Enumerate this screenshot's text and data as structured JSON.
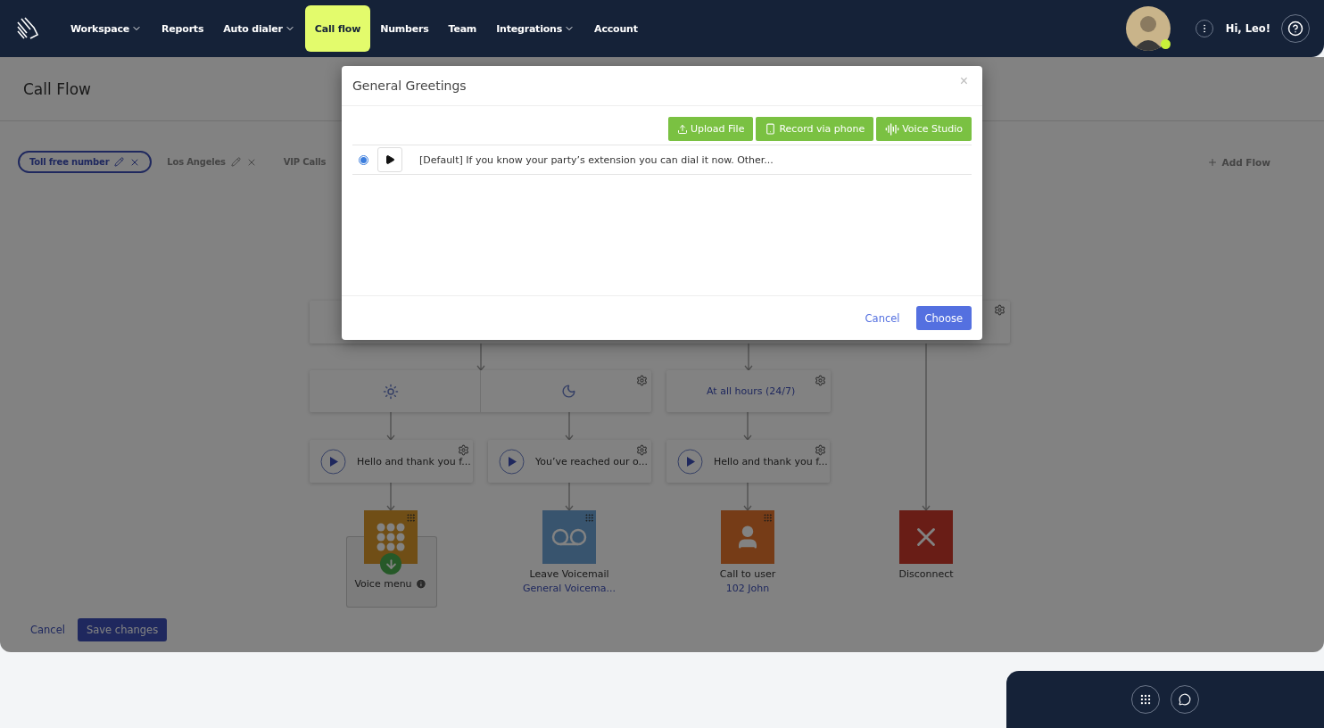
{
  "nav": {
    "items": [
      {
        "label": "Workspace",
        "has_menu": true,
        "selected": false
      },
      {
        "label": "Reports",
        "has_menu": false,
        "selected": false
      },
      {
        "label": "Auto dialer",
        "has_menu": true,
        "selected": false
      },
      {
        "label": "Call flow",
        "has_menu": false,
        "selected": true
      },
      {
        "label": "Numbers",
        "has_menu": false,
        "selected": false
      },
      {
        "label": "Team",
        "has_menu": false,
        "selected": false
      },
      {
        "label": "Integrations",
        "has_menu": true,
        "selected": false
      },
      {
        "label": "Account",
        "has_menu": false,
        "selected": false
      }
    ],
    "user": {
      "greeting": "Hi, Leo!",
      "online": true
    }
  },
  "page": {
    "title": "Call Flow",
    "flow_tabs": [
      {
        "label": "Toll free number",
        "selected": true
      },
      {
        "label": "Los Angeles",
        "selected": false
      },
      {
        "label": "VIP Calls",
        "selected": false
      }
    ],
    "add_flow": "Add Flow",
    "time_conditions": [
      {
        "kind": "day"
      },
      {
        "kind": "night"
      },
      {
        "kind": "text",
        "label": "At all hours (24/7)"
      }
    ],
    "prompts": [
      {
        "text": "Hello and thank you f..."
      },
      {
        "text": "You’ve reached our o..."
      },
      {
        "text": "Hello and thank you f..."
      }
    ],
    "actions": [
      {
        "kind": "voice_menu",
        "label": "Voice menu"
      },
      {
        "kind": "voicemail",
        "label": "Leave Voicemail",
        "detail": "General Voicema..."
      },
      {
        "kind": "user",
        "label": "Call to user",
        "detail": "102 John"
      },
      {
        "kind": "disconnect",
        "label": "Disconnect"
      }
    ],
    "cancel": "Cancel",
    "save": "Save changes"
  },
  "modal": {
    "title": "General Greetings",
    "close": "×",
    "buttons": [
      {
        "kind": "upload",
        "label": "Upload File"
      },
      {
        "kind": "phone",
        "label": "Record via phone"
      },
      {
        "kind": "studio",
        "label": "Voice Studio"
      }
    ],
    "greetings": [
      {
        "text": "[Default] If you know your party’s extension you can dial it now. Other...",
        "selected": true
      }
    ],
    "cancel": "Cancel",
    "choose": "Choose"
  }
}
